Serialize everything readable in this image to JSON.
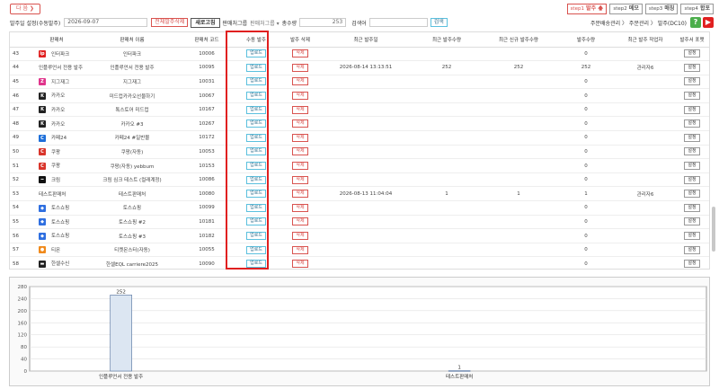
{
  "header": {
    "next_button": "다 음 ❯",
    "date_label": "발주일 설정(수동발주)",
    "date_value": "2026-09-07",
    "delete_all_button": "전체발주삭제",
    "refresh_button": "새로고침",
    "shop_group_label": "판매처그룹",
    "shop_group_select": "판매처그룹 ▾",
    "total_count_label": "총수량",
    "total_count_value": "253",
    "search_label": "검색어",
    "search_button": "검색"
  },
  "steps": [
    {
      "prefix": "step1",
      "label": "발주 🡅",
      "red": true
    },
    {
      "prefix": "step2",
      "label": "메모",
      "red": false
    },
    {
      "prefix": "step3",
      "label": "매칭",
      "red": false
    },
    {
      "prefix": "step4",
      "label": "합포",
      "red": false
    }
  ],
  "breadcrumb": "주문배송관리 〉 주문관리 〉 발주(DC10)",
  "help_icon_text": "?",
  "colors": {
    "accent_red": "#d9534f",
    "accent_blue": "#5bc0de",
    "bar_fill": "#dce6f2",
    "bar_stroke": "#4f6e9c",
    "highlight_red": "#e02020"
  },
  "table": {
    "columns": [
      "",
      "판매처",
      "판매처 이름",
      "판매처 코드",
      "수동 발주",
      "발주 삭제",
      "최근 발주일",
      "최근 발주수량",
      "최근 신규 발주수량",
      "발주수량",
      "최근 발주 작업자",
      "발주서 포맷"
    ],
    "upload_label": "업로드",
    "delete_label": "삭제",
    "setting_label": "설정",
    "rows": [
      {
        "no": "43",
        "shop": "인터파크",
        "icon": "interpark-icon",
        "icolor": "#e02020",
        "name": "인터파크",
        "code": "10006",
        "date": "",
        "recent_qty": "",
        "new_qty": "",
        "qty": "0",
        "worker": ""
      },
      {
        "no": "44",
        "shop": "인플루언서 전용 발주",
        "icon": "",
        "icolor": "",
        "name": "인플루언서 전용 발주",
        "code": "10095",
        "date": "2026-08-14 13:13:51",
        "recent_qty": "252",
        "new_qty": "252",
        "qty": "252",
        "worker": "관리자6"
      },
      {
        "no": "45",
        "shop": "지그재그",
        "icon": "zigzag-icon",
        "icolor": "#e0358c",
        "name": "지그재그",
        "code": "10031",
        "date": "",
        "recent_qty": "",
        "new_qty": "",
        "qty": "0",
        "worker": ""
      },
      {
        "no": "46",
        "shop": "카카오",
        "icon": "kakao-icon",
        "icolor": "#222222",
        "name": "미드컵카카오선물하기",
        "code": "10067",
        "date": "",
        "recent_qty": "",
        "new_qty": "",
        "qty": "0",
        "worker": ""
      },
      {
        "no": "47",
        "shop": "카카오",
        "icon": "kakao-icon",
        "icolor": "#222222",
        "name": "톡스토어 미드컵",
        "code": "10167",
        "date": "",
        "recent_qty": "",
        "new_qty": "",
        "qty": "0",
        "worker": ""
      },
      {
        "no": "48",
        "shop": "카카오",
        "icon": "kakao-icon",
        "icolor": "#222222",
        "name": "카카오 #3",
        "code": "10267",
        "date": "",
        "recent_qty": "",
        "new_qty": "",
        "qty": "0",
        "worker": ""
      },
      {
        "no": "49",
        "shop": "카페24",
        "icon": "cafe24-icon",
        "icolor": "#1e6fd9",
        "name": "카페24 #일반몰",
        "code": "10172",
        "date": "",
        "recent_qty": "",
        "new_qty": "",
        "qty": "0",
        "worker": ""
      },
      {
        "no": "50",
        "shop": "쿠팡",
        "icon": "coupang-icon",
        "icolor": "#d9352b",
        "name": "쿠팡(자동)",
        "code": "10053",
        "date": "",
        "recent_qty": "",
        "new_qty": "",
        "qty": "0",
        "worker": ""
      },
      {
        "no": "51",
        "shop": "쿠팡",
        "icon": "coupang-icon",
        "icolor": "#d9352b",
        "name": "쿠팡(자동) yebbum",
        "code": "10153",
        "date": "",
        "recent_qty": "",
        "new_qty": "",
        "qty": "0",
        "worker": ""
      },
      {
        "no": "52",
        "shop": "크림",
        "icon": "kream-icon",
        "icolor": "#111111",
        "name": "크림 심크 테스트 (컬래계정)",
        "code": "10086",
        "date": "",
        "recent_qty": "",
        "new_qty": "",
        "qty": "0",
        "worker": ""
      },
      {
        "no": "53",
        "shop": "테스트판매처",
        "icon": "",
        "icolor": "",
        "name": "테스트판매처",
        "code": "10080",
        "date": "2026-08-13 11:04:04",
        "recent_qty": "1",
        "new_qty": "1",
        "qty": "1",
        "worker": "관리자6"
      },
      {
        "no": "54",
        "shop": "토스쇼핑",
        "icon": "toss-icon",
        "icolor": "#2f6fe0",
        "name": "토스쇼핑",
        "code": "10099",
        "date": "",
        "recent_qty": "",
        "new_qty": "",
        "qty": "0",
        "worker": ""
      },
      {
        "no": "55",
        "shop": "토스쇼핑",
        "icon": "toss-icon",
        "icolor": "#2f6fe0",
        "name": "토스쇼핑 #2",
        "code": "10181",
        "date": "",
        "recent_qty": "",
        "new_qty": "",
        "qty": "0",
        "worker": ""
      },
      {
        "no": "56",
        "shop": "토스쇼핑",
        "icon": "toss-icon",
        "icolor": "#2f6fe0",
        "name": "토스쇼핑 #3",
        "code": "10182",
        "date": "",
        "recent_qty": "",
        "new_qty": "",
        "qty": "0",
        "worker": ""
      },
      {
        "no": "57",
        "shop": "티몬",
        "icon": "tmon-icon",
        "icolor": "#f08a1c",
        "name": "티켓몬스터(자동)",
        "code": "10055",
        "date": "",
        "recent_qty": "",
        "new_qty": "",
        "qty": "0",
        "worker": ""
      },
      {
        "no": "58",
        "shop": "한셀수신",
        "icon": "hansel-icon",
        "icolor": "#222222",
        "name": "한셀EQL carriere2025",
        "code": "10090",
        "date": "",
        "recent_qty": "",
        "new_qty": "",
        "qty": "0",
        "worker": ""
      }
    ]
  },
  "chart_data": {
    "type": "bar",
    "categories": [
      "인플루언서 전용 발주",
      "테스트판매처"
    ],
    "values": [
      252,
      1
    ],
    "title": "",
    "xlabel": "",
    "ylabel": "",
    "ylim": [
      0,
      280
    ],
    "yticks": [
      0,
      40,
      80,
      120,
      160,
      200,
      240,
      280
    ],
    "grid": true,
    "data_labels": true
  }
}
